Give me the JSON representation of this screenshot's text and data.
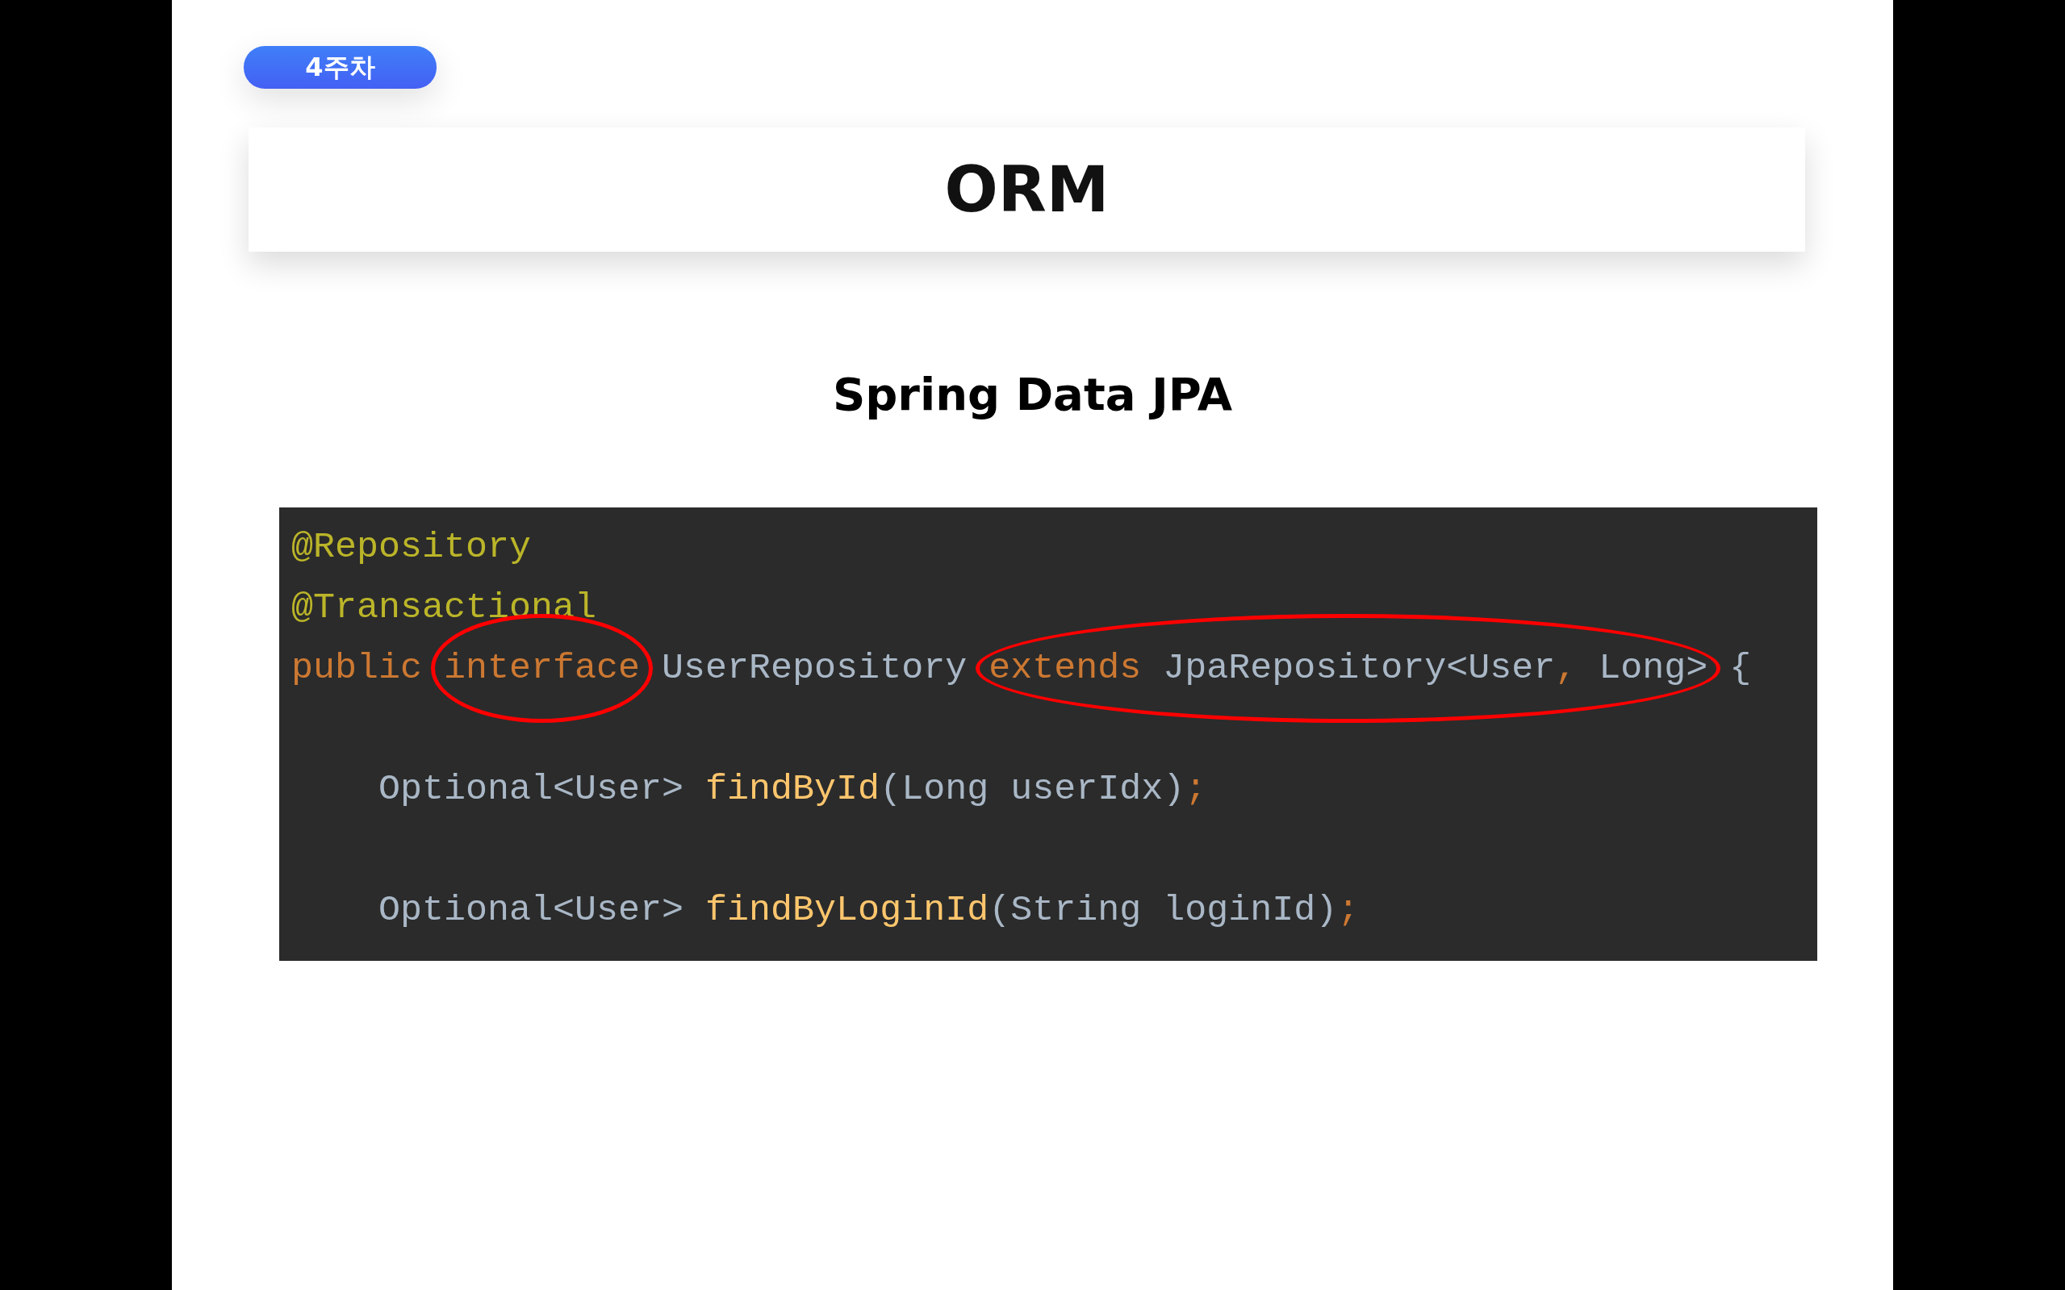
{
  "badge": "4주차",
  "title": "ORM",
  "subtitle": "Spring Data JPA",
  "code": {
    "lines": [
      {
        "kind": "code",
        "segments": [
          {
            "circled": false,
            "tokens": [
              {
                "kind": "annotation",
                "text": "@Repository"
              }
            ]
          }
        ]
      },
      {
        "kind": "code",
        "segments": [
          {
            "circled": false,
            "tokens": [
              {
                "kind": "annotation",
                "text": "@Transactional"
              }
            ]
          }
        ]
      },
      {
        "kind": "code",
        "segments": [
          {
            "circled": false,
            "tokens": [
              {
                "kind": "keyword",
                "text": "public "
              }
            ]
          },
          {
            "circled": true,
            "tokens": [
              {
                "kind": "keyword",
                "text": "interface"
              }
            ]
          },
          {
            "circled": false,
            "tokens": [
              {
                "kind": "plain",
                "text": " UserRepository "
              }
            ]
          },
          {
            "circled": true,
            "tokens": [
              {
                "kind": "keyword",
                "text": "extends"
              },
              {
                "kind": "plain",
                "text": " JpaRepository<User"
              },
              {
                "kind": "keyword",
                "text": ","
              },
              {
                "kind": "plain",
                "text": " Long>"
              }
            ]
          },
          {
            "circled": false,
            "tokens": [
              {
                "kind": "plain",
                "text": " {"
              }
            ]
          }
        ]
      },
      {
        "kind": "blank"
      },
      {
        "kind": "code",
        "segments": [
          {
            "circled": false,
            "tokens": [
              {
                "kind": "plain",
                "text": "    Optional<User> "
              },
              {
                "kind": "method",
                "text": "findById"
              },
              {
                "kind": "plain",
                "text": "(Long userIdx)"
              },
              {
                "kind": "keyword",
                "text": ";"
              }
            ]
          }
        ]
      },
      {
        "kind": "blank"
      },
      {
        "kind": "code",
        "segments": [
          {
            "circled": false,
            "tokens": [
              {
                "kind": "plain",
                "text": "    Optional<User> "
              },
              {
                "kind": "method",
                "text": "findByLoginId"
              },
              {
                "kind": "plain",
                "text": "(String loginId)"
              },
              {
                "kind": "keyword",
                "text": ";"
              }
            ]
          }
        ]
      }
    ]
  }
}
